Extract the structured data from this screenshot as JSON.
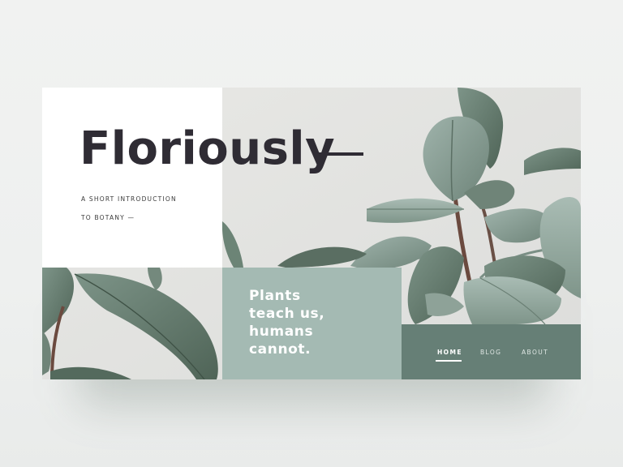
{
  "hero": {
    "title": "Floriously",
    "subtitle_lines": [
      "A SHORT INTRODUCTION",
      "TO BOTANY —"
    ]
  },
  "quote": {
    "lines": [
      "Plants",
      "teach us,",
      "humans",
      "cannot."
    ]
  },
  "nav": {
    "items": [
      {
        "label": "HOME",
        "active": true
      },
      {
        "label": "BLOG",
        "active": false
      },
      {
        "label": "ABOUT",
        "active": false
      }
    ]
  },
  "colors": {
    "background": "#eef0ef",
    "title": "#2f2c34",
    "quote_block": "#a4bab3",
    "nav_block": "#667f76",
    "leaf_dark": "#5f7366",
    "leaf_light": "#8fa69c"
  },
  "images": {
    "hero_photo": "rubber-plant-photo",
    "corner_photo": "rubber-plant-leaves-photo"
  }
}
